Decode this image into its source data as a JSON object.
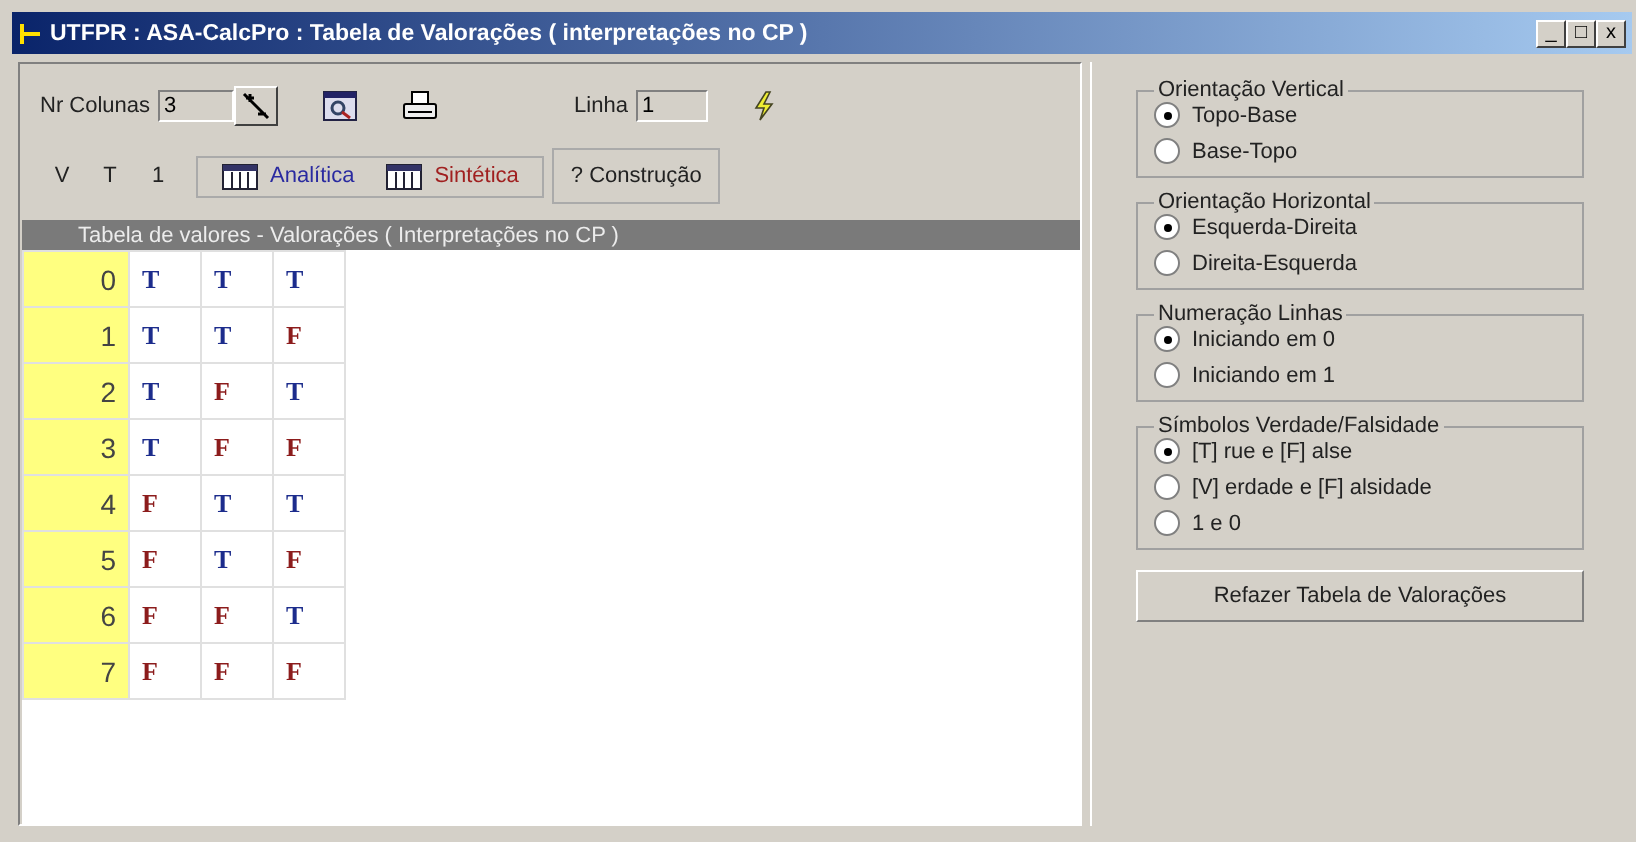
{
  "window": {
    "title": "UTFPR : ASA-CalcPro : Tabela de Valorações ( interpretações no CP )",
    "controls": [
      "_",
      "□",
      "x"
    ]
  },
  "toolbar": {
    "columns_label": "Nr Colunas",
    "columns_value": "3",
    "line_label": "Linha",
    "line_value": "1",
    "symbols": [
      "V",
      "T",
      "1"
    ],
    "view_buttons": [
      {
        "label": "Analítica",
        "kind": "analytic"
      },
      {
        "label": "Sintética",
        "kind": "synthetic"
      }
    ],
    "construction_button": "? Construção"
  },
  "table": {
    "title": "Tabela de valores - Valorações ( Interpretações no CP )",
    "rows": [
      {
        "index": "0",
        "cells": [
          {
            "text": "T",
            "truth": true
          },
          {
            "text": "T",
            "truth": true
          },
          {
            "text": "T",
            "truth": true
          }
        ]
      },
      {
        "index": "1",
        "cells": [
          {
            "text": "T",
            "truth": true
          },
          {
            "text": "T",
            "truth": true
          },
          {
            "text": "F",
            "truth": false
          }
        ]
      },
      {
        "index": "2",
        "cells": [
          {
            "text": "T",
            "truth": true
          },
          {
            "text": "F",
            "truth": false
          },
          {
            "text": "T",
            "truth": true
          }
        ]
      },
      {
        "index": "3",
        "cells": [
          {
            "text": "T",
            "truth": true
          },
          {
            "text": "F",
            "truth": false
          },
          {
            "text": "F",
            "truth": false
          }
        ]
      },
      {
        "index": "4",
        "cells": [
          {
            "text": "F",
            "truth": false
          },
          {
            "text": "T",
            "truth": true
          },
          {
            "text": "T",
            "truth": true
          }
        ]
      },
      {
        "index": "5",
        "cells": [
          {
            "text": "F",
            "truth": false
          },
          {
            "text": "T",
            "truth": true
          },
          {
            "text": "F",
            "truth": false
          }
        ]
      },
      {
        "index": "6",
        "cells": [
          {
            "text": "F",
            "truth": false
          },
          {
            "text": "F",
            "truth": false
          },
          {
            "text": "T",
            "truth": true
          }
        ]
      },
      {
        "index": "7",
        "cells": [
          {
            "text": "F",
            "truth": false
          },
          {
            "text": "F",
            "truth": false
          },
          {
            "text": "F",
            "truth": false
          }
        ]
      }
    ]
  },
  "options": [
    {
      "title": "Orientação Vertical",
      "choices": [
        {
          "label": "Topo-Base",
          "selected": true
        },
        {
          "label": "Base-Topo",
          "selected": false
        }
      ]
    },
    {
      "title": "Orientação Horizontal",
      "choices": [
        {
          "label": "Esquerda-Direita",
          "selected": true
        },
        {
          "label": "Direita-Esquerda",
          "selected": false
        }
      ]
    },
    {
      "title": "Numeração Linhas",
      "choices": [
        {
          "label": "Iniciando em 0",
          "selected": true
        },
        {
          "label": "Iniciando em 1",
          "selected": false
        }
      ]
    },
    {
      "title": "Símbolos Verdade/Falsidade",
      "choices": [
        {
          "label": "[T] rue e [F] alse",
          "selected": true
        },
        {
          "label": "[V] erdade e [F] alsidade",
          "selected": false
        },
        {
          "label": "1 e 0",
          "selected": false
        }
      ]
    }
  ],
  "rebuild_button": "Refazer Tabela de Valorações"
}
